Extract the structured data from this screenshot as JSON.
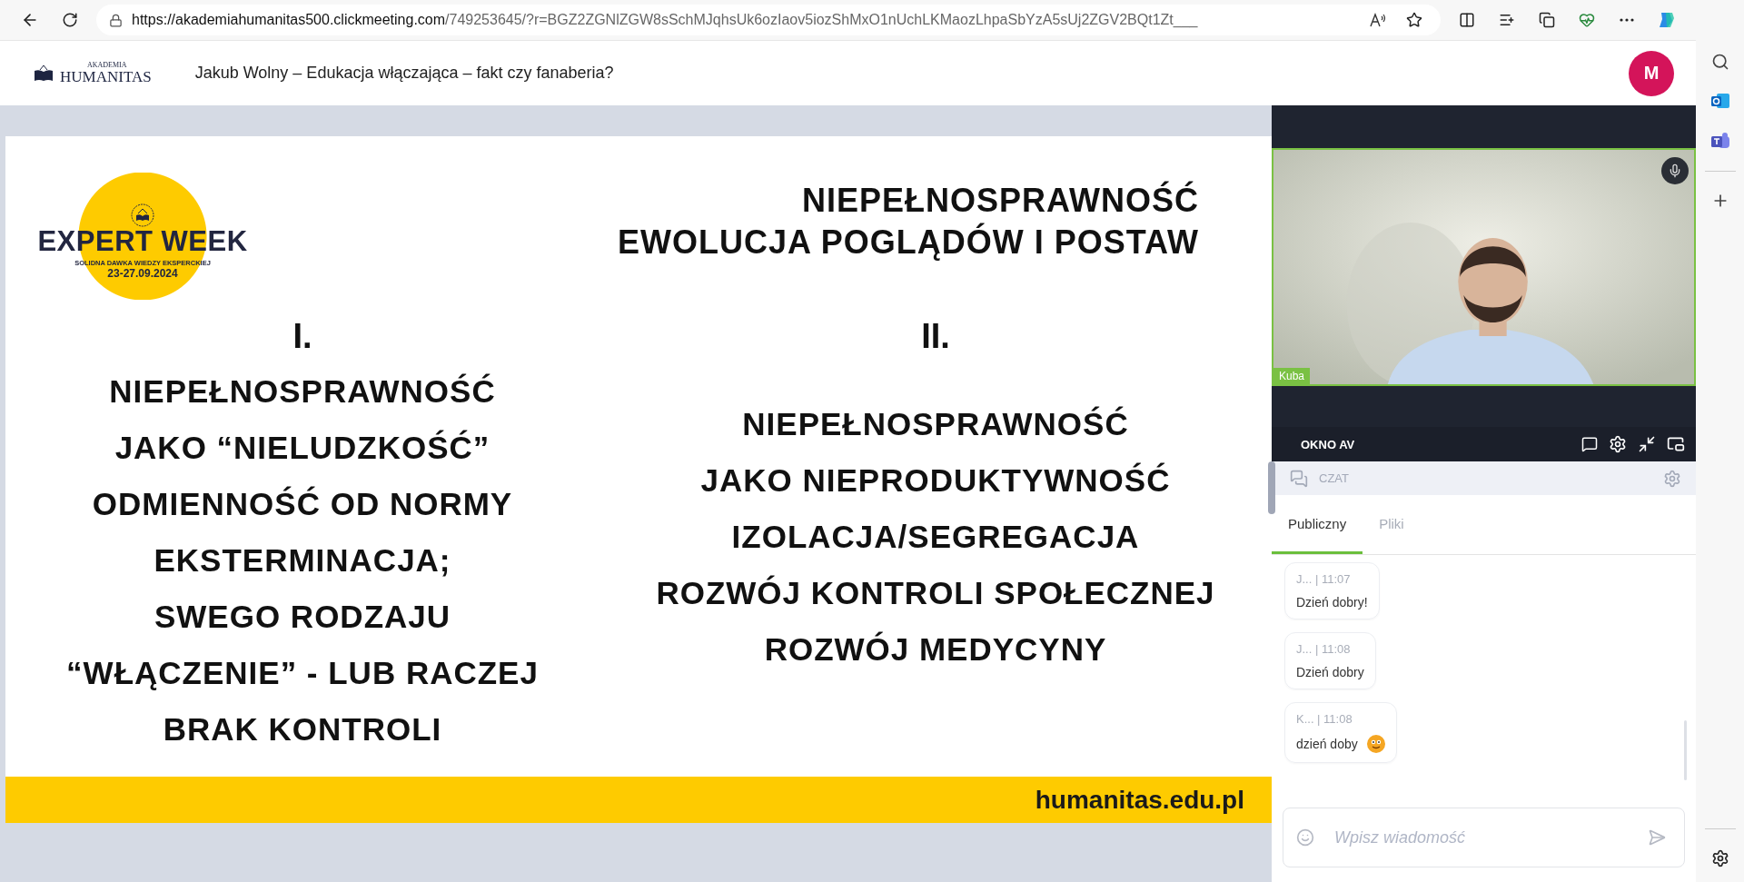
{
  "browser": {
    "url_host": "https://akademiahumanitas500.clickmeeting.com",
    "url_rest": "/749253645/?r=BGZ2ZGNlZGW8sSchMJqhsUk6ozIaov5iozShMxO1nUchLKMaozLhpaSbYzA5sUj2ZGV2BQt1Zt___"
  },
  "header": {
    "brand_top": "AKADEMIA",
    "brand_name": "HUMANITAS",
    "title": "Jakub Wolny – Edukacja włączająca – fakt czy fanaberia?",
    "avatar": "M"
  },
  "slide": {
    "logo": {
      "title": "EXPERT WEEK",
      "tagline": "SOLIDNA DAWKA WIEDZY EKSPERCKIEJ",
      "dates": "23-27.09.2024"
    },
    "title_lines": [
      "NIEPEŁNOSPRAWNOŚĆ",
      "EWOLUCJA POGLĄDÓW I POSTAW"
    ],
    "columns": [
      {
        "numeral": "I.",
        "lines": [
          "NIEPEŁNOSPRAWNOŚĆ",
          "JAKO “NIELUDZKOŚĆ”",
          "ODMIENNOŚĆ OD NORMY",
          "EKSTERMINACJA;",
          "SWEGO RODZAJU",
          "“WŁĄCZENIE” - LUB RACZEJ",
          "BRAK KONTROLI"
        ]
      },
      {
        "numeral": "II.",
        "lines": [
          "NIEPEŁNOSPRAWNOŚĆ",
          "JAKO NIEPRODUKTYWNOŚĆ",
          "IZOLACJA/SEGREGACJA",
          "ROZWÓJ KONTROLI SPOŁECZNEJ",
          "ROZWÓJ MEDYCYNY"
        ]
      }
    ],
    "footer": "humanitas.edu.pl"
  },
  "video": {
    "name": "Kuba",
    "panel_title": "OKNO AV"
  },
  "chat": {
    "title": "CZAT",
    "tabs": [
      {
        "label": "Publiczny",
        "selected": true
      },
      {
        "label": "Pliki",
        "selected": false
      }
    ],
    "messages": [
      {
        "meta": "J... | 11:07",
        "text": "Dzień dobry!",
        "emoji": false
      },
      {
        "meta": "J... | 11:08",
        "text": "Dzień dobry",
        "emoji": false
      },
      {
        "meta": "K... | 11:08",
        "text": "dzień doby",
        "emoji": true
      }
    ],
    "input": {
      "placeholder": "Wpisz wiadomość"
    }
  }
}
